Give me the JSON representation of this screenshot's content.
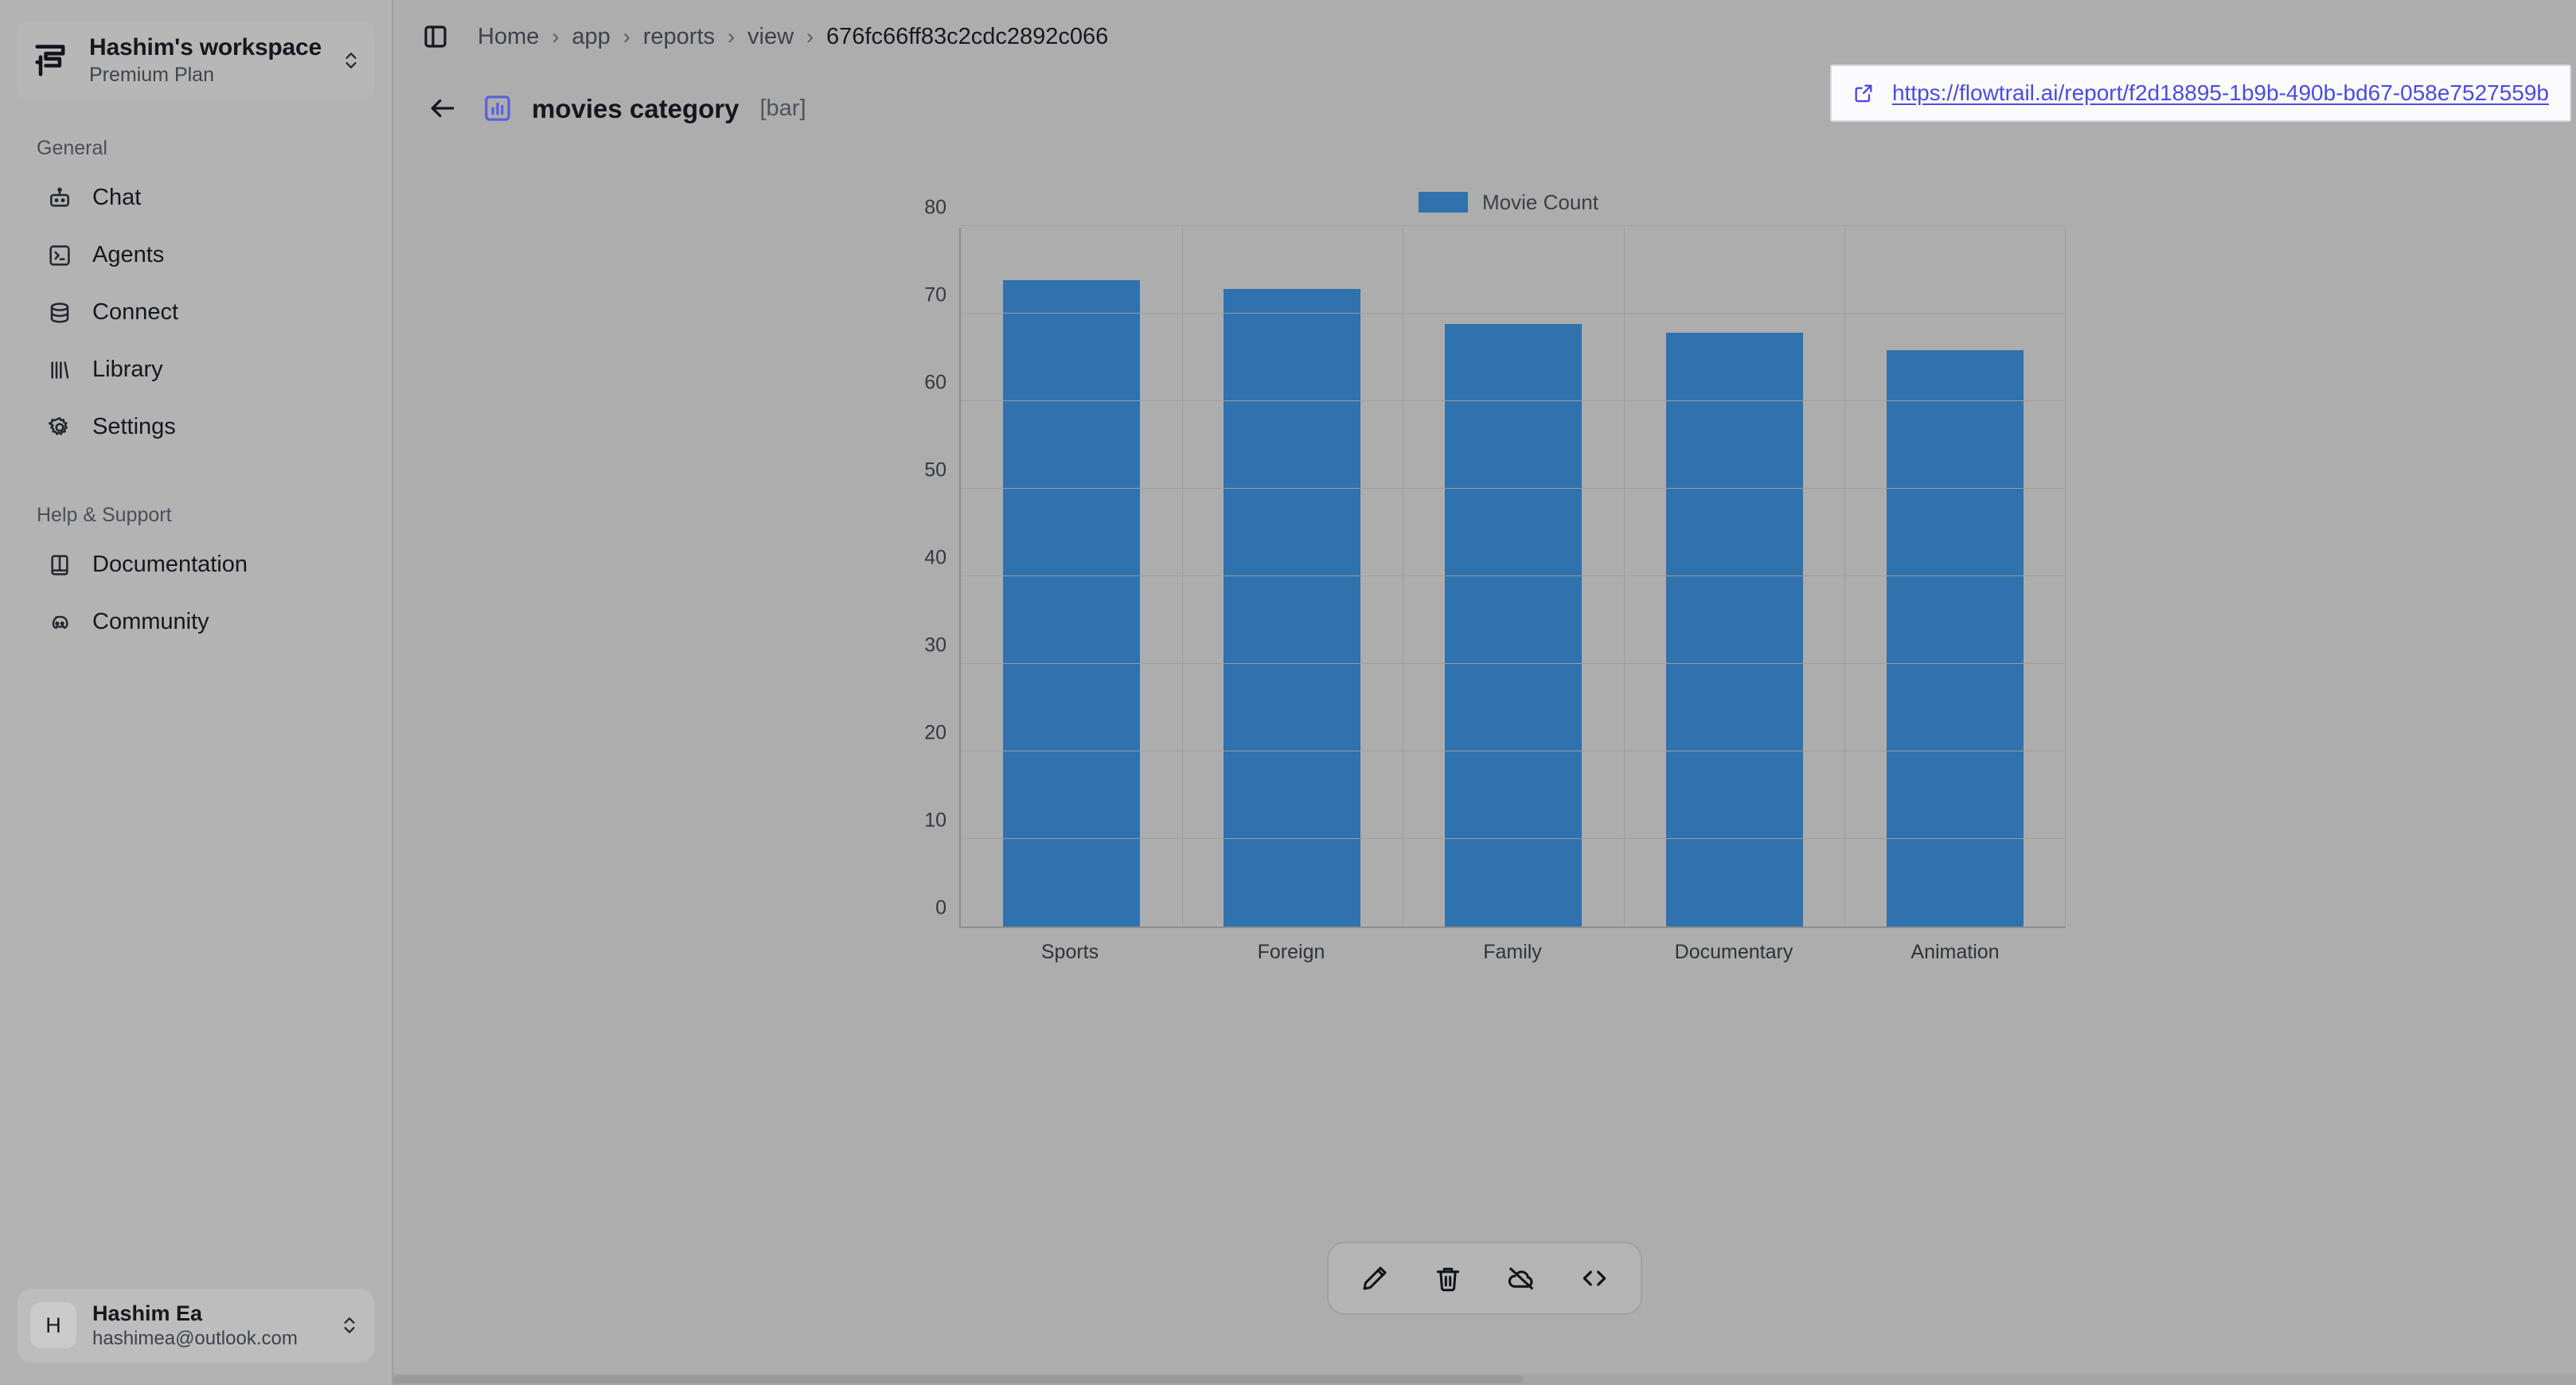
{
  "sidebar": {
    "workspace": {
      "name": "Hashim's workspace",
      "plan": "Premium Plan",
      "logo_icon": "flowtrail-logo-icon",
      "switch_icon": "chevron-up-down-icon"
    },
    "sections": [
      {
        "label": "General",
        "items": [
          {
            "label": "Chat",
            "icon": "bot-icon"
          },
          {
            "label": "Agents",
            "icon": "terminal-square-icon"
          },
          {
            "label": "Connect",
            "icon": "database-icon"
          },
          {
            "label": "Library",
            "icon": "library-icon"
          },
          {
            "label": "Settings",
            "icon": "gear-icon"
          }
        ]
      },
      {
        "label": "Help & Support",
        "items": [
          {
            "label": "Documentation",
            "icon": "book-icon"
          },
          {
            "label": "Community",
            "icon": "discord-icon"
          }
        ]
      }
    ],
    "user": {
      "avatar_initial": "H",
      "name": "Hashim Ea",
      "email": "hashimea@outlook.com",
      "switch_icon": "chevron-up-down-icon"
    }
  },
  "header": {
    "panel_toggle_icon": "panel-left-icon",
    "breadcrumb": [
      "Home",
      "app",
      "reports",
      "view",
      "676fc66ff83c2cdc2892c066"
    ],
    "breadcrumb_separator": "›",
    "back_icon": "arrow-left-icon",
    "report_icon": "bar-chart-icon",
    "report_title": "movies category",
    "report_type": "[bar]"
  },
  "url_banner": {
    "icon": "external-link-icon",
    "url": "https://flowtrail.ai/report/f2d18895-1b9b-490b-bd67-058e7527559b"
  },
  "toolbar": {
    "buttons": [
      {
        "name": "edit-button",
        "icon": "pencil-icon"
      },
      {
        "name": "delete-button",
        "icon": "trash-icon"
      },
      {
        "name": "unpublish-button",
        "icon": "cloud-off-icon"
      },
      {
        "name": "embed-code-button",
        "icon": "code-icon"
      }
    ]
  },
  "colors": {
    "bar": "#2f72ae",
    "accent": "#4f46e5",
    "link": "#4a4ce0",
    "page_bg": "#adadad",
    "sidebar_bg": "#b3b3b3"
  },
  "chart_data": {
    "type": "bar",
    "title": "",
    "categories": [
      "Sports",
      "Foreign",
      "Family",
      "Documentary",
      "Animation"
    ],
    "series": [
      {
        "name": "Movie Count",
        "values": [
          74,
          73,
          69,
          68,
          66
        ],
        "color": "#2f72ae"
      }
    ],
    "xlabel": "",
    "ylabel": "",
    "ylim": [
      0,
      80
    ],
    "yticks": [
      0,
      10,
      20,
      30,
      40,
      50,
      60,
      70,
      80
    ],
    "grid": true,
    "legend": {
      "position": "top",
      "entries": [
        "Movie Count"
      ]
    }
  }
}
